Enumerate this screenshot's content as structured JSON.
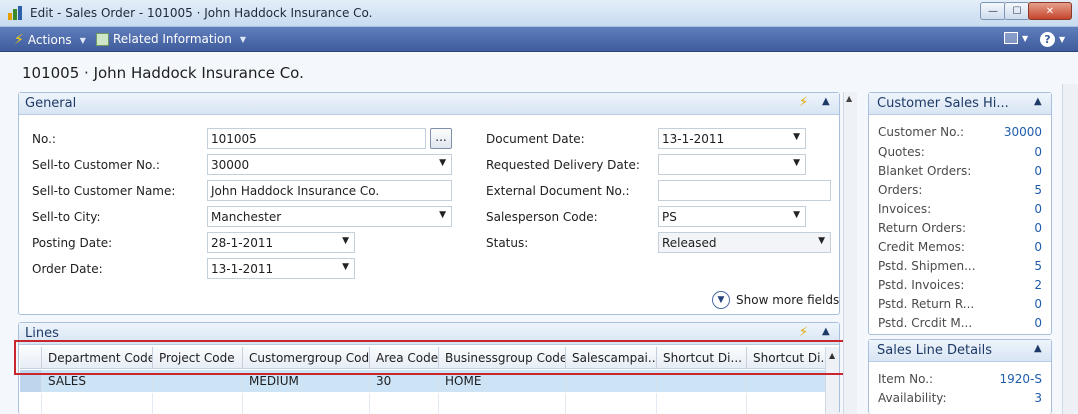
{
  "window": {
    "title": "Edit - Sales Order - 101005 · John Haddock Insurance Co.",
    "minimize": "—",
    "maximize": "☐",
    "close": "✕"
  },
  "ribbon": {
    "actions": "Actions",
    "related": "Related Information"
  },
  "page": {
    "title": "101005 · John Haddock Insurance Co."
  },
  "general": {
    "title": "General",
    "left_fields": [
      {
        "label": "No.:",
        "value": "101005"
      },
      {
        "label": "Sell-to Customer No.:",
        "value": "30000"
      },
      {
        "label": "Sell-to Customer Name:",
        "value": "John Haddock Insurance Co."
      },
      {
        "label": "Sell-to City:",
        "value": "Manchester"
      },
      {
        "label": "Posting Date:",
        "value": "28-1-2011"
      },
      {
        "label": "Order Date:",
        "value": "13-1-2011"
      }
    ],
    "right_fields": [
      {
        "label": "Document Date:",
        "value": "13-1-2011"
      },
      {
        "label": "Requested Delivery Date:",
        "value": ""
      },
      {
        "label": "External Document No.:",
        "value": ""
      },
      {
        "label": "Salesperson Code:",
        "value": "PS"
      },
      {
        "label": "Status:",
        "value": "Released"
      }
    ],
    "assist_label": "...",
    "show_more": "Show more fields"
  },
  "lines": {
    "title": "Lines",
    "columns": [
      "Department Code",
      "Project Code",
      "Customergroup Code",
      "Area Code",
      "Businessgroup Code",
      "Salescampai...",
      "Shortcut Di...",
      "Shortcut Di..."
    ],
    "row": [
      "SALES",
      "",
      "MEDIUM",
      "30",
      "HOME",
      "",
      "",
      ""
    ]
  },
  "factbox_customer": {
    "title": "Customer Sales Hi...",
    "items": [
      {
        "label": "Customer No.:",
        "value": "30000"
      },
      {
        "label": "Quotes:",
        "value": "0"
      },
      {
        "label": "Blanket Orders:",
        "value": "0"
      },
      {
        "label": "Orders:",
        "value": "5"
      },
      {
        "label": "Invoices:",
        "value": "0"
      },
      {
        "label": "Return Orders:",
        "value": "0"
      },
      {
        "label": "Credit Memos:",
        "value": "0"
      },
      {
        "label": "Pstd. Shipmen...",
        "value": "5"
      },
      {
        "label": "Pstd. Invoices:",
        "value": "2"
      },
      {
        "label": "Pstd. Return R...",
        "value": "0"
      },
      {
        "label": "Pstd. Crcdit M...",
        "value": "0"
      }
    ]
  },
  "factbox_line": {
    "title": "Sales Line Details",
    "items": [
      {
        "label": "Item No.:",
        "value": "1920-S"
      },
      {
        "label": "Availability:",
        "value": "3"
      }
    ]
  },
  "colors": {
    "ribbon": "#3f5c9c",
    "selected_row": "#cde4f7",
    "highlight": "#c8262c",
    "link": "#1f5dab"
  }
}
